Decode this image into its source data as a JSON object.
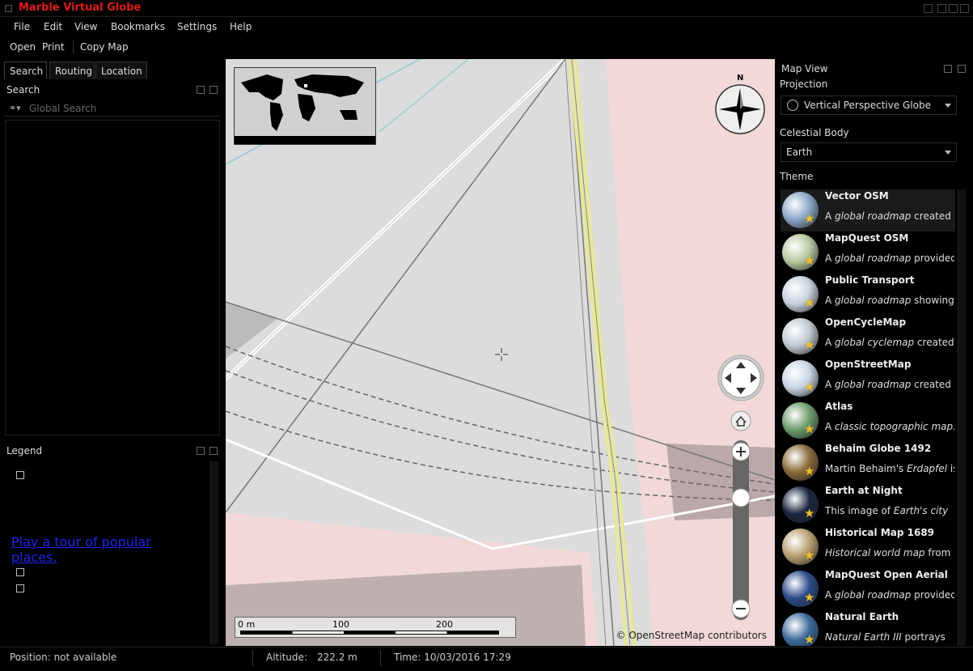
{
  "window": {
    "title": "Marble Virtual Globe"
  },
  "menu": [
    "File",
    "Edit",
    "View",
    "Bookmarks",
    "Settings",
    "Help"
  ],
  "toolbar": {
    "open": "Open",
    "print": "Print",
    "copy_map": "Copy Map"
  },
  "left_tabs": [
    "Search",
    "Routing",
    "Location"
  ],
  "search": {
    "header": "Search",
    "placeholder": "Global Search"
  },
  "legend": {
    "header": "Legend",
    "tour_link": "Play a tour of popular places."
  },
  "map": {
    "attribution": "© OpenStreetMap contributors",
    "scale_labels": [
      "0 m",
      "100",
      "200"
    ],
    "compass_label": "N"
  },
  "mapview": {
    "header": "Map View",
    "projection_label": "Projection",
    "projection_value": "Vertical Perspective Globe",
    "celestial_label": "Celestial Body",
    "celestial_value": "Earth",
    "theme_label": "Theme",
    "themes": [
      {
        "name": "Vector OSM",
        "desc_pre": "A ",
        "desc_em": "global roadmap",
        "desc_post": " created",
        "globe": "#8aa6c8",
        "selected": true
      },
      {
        "name": "MapQuest OSM",
        "desc_pre": "A ",
        "desc_em": "global roadmap",
        "desc_post": " provided",
        "globe": "#b8c8a0",
        "selected": false
      },
      {
        "name": "Public Transport",
        "desc_pre": "A ",
        "desc_em": "global roadmap",
        "desc_post": " showing",
        "globe": "#c8d0dc",
        "selected": false
      },
      {
        "name": "OpenCycleMap",
        "desc_pre": "A ",
        "desc_em": "global cyclemap",
        "desc_post": " created",
        "globe": "#c0c8d0",
        "selected": false
      },
      {
        "name": "OpenStreetMap",
        "desc_pre": "A ",
        "desc_em": "global roadmap",
        "desc_post": " created",
        "globe": "#c8d4e4",
        "selected": false
      },
      {
        "name": "Atlas",
        "desc_pre": "A ",
        "desc_em": "classic topographic map.",
        "desc_post": "",
        "globe": "#6c9c6c",
        "selected": false
      },
      {
        "name": "Behaim Globe 1492",
        "desc_pre": "Martin Behaim's ",
        "desc_em": "Erdapfel",
        "desc_post": " is",
        "globe": "#8a6a3a",
        "selected": false
      },
      {
        "name": "Earth at Night",
        "desc_pre": "This image of ",
        "desc_em": "Earth's city",
        "desc_post": "",
        "globe": "#1a2440",
        "selected": false
      },
      {
        "name": "Historical Map 1689",
        "desc_pre": "",
        "desc_em": "Historical world map",
        "desc_post": " from",
        "globe": "#b8a070",
        "selected": false
      },
      {
        "name": "MapQuest Open Aerial",
        "desc_pre": "A ",
        "desc_em": "global roadmap",
        "desc_post": " provided",
        "globe": "#2a4a8a",
        "selected": false
      },
      {
        "name": "Natural Earth",
        "desc_pre": "",
        "desc_em": "Natural Earth III",
        "desc_post": " portrays",
        "globe": "#3a6a9a",
        "selected": false
      }
    ]
  },
  "status": {
    "position": "Position: not available",
    "altitude_label": "Altitude:",
    "altitude_value": "222.2 m",
    "time": "Time: 10/03/2016 17:29"
  },
  "colors": {
    "title": "#e01818",
    "link": "#2222ee",
    "star": "#f0c020"
  }
}
